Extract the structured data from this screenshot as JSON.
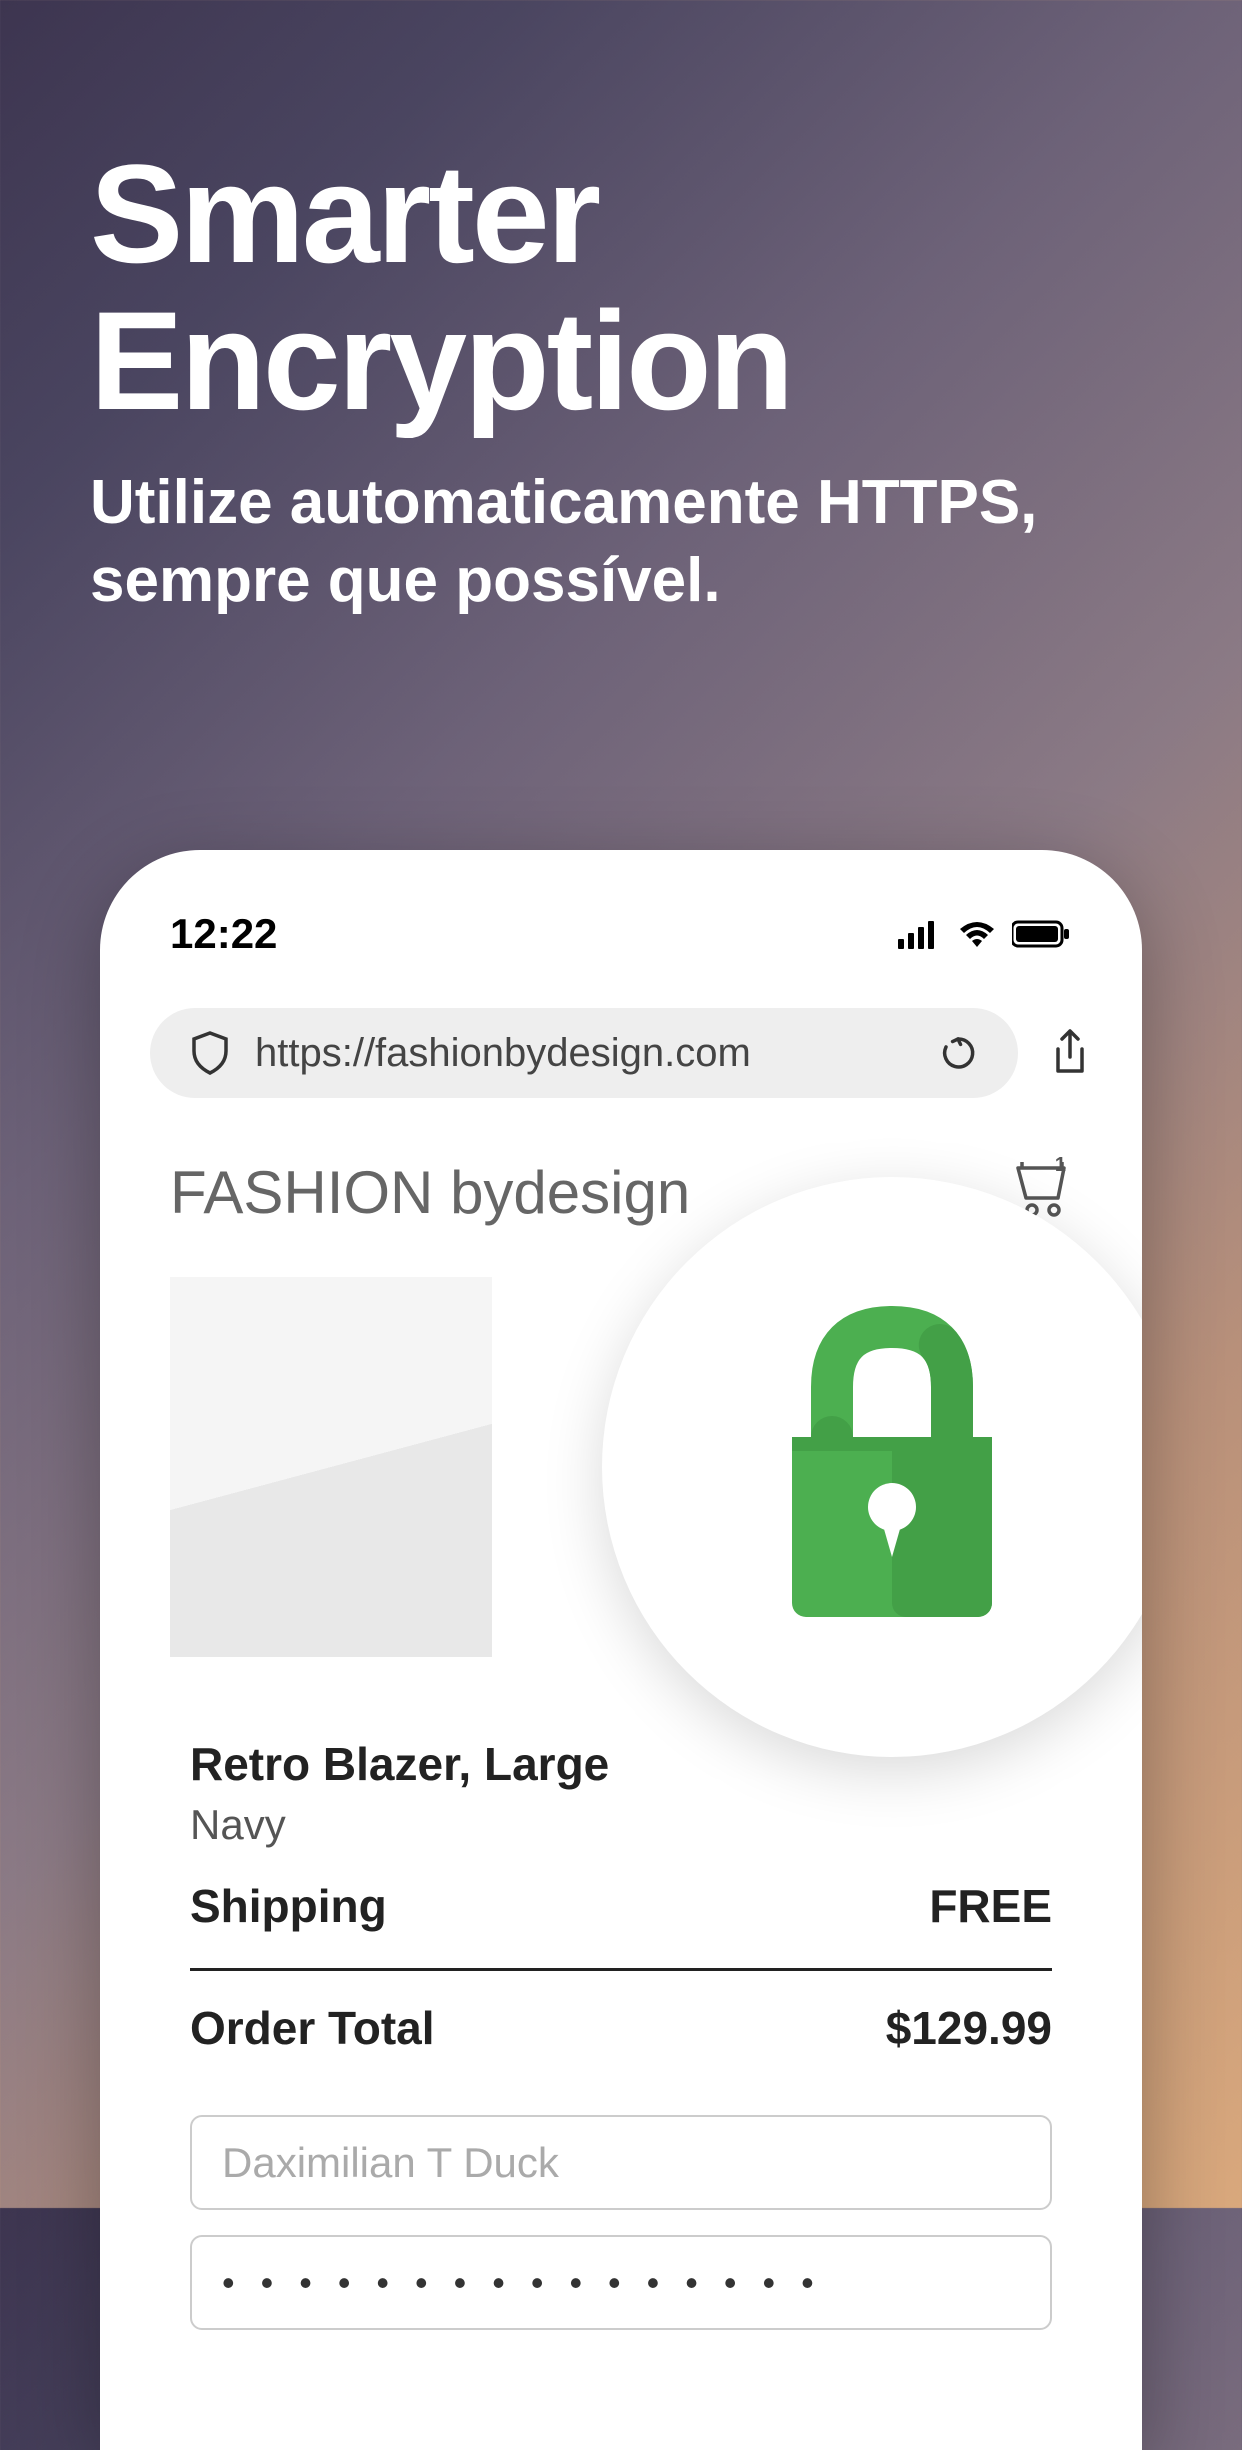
{
  "hero": {
    "title": "Smarter Encryption",
    "subtitle": "Utilize automaticamente HTTPS, sempre que possível."
  },
  "phone": {
    "statusBar": {
      "time": "12:22"
    },
    "addressBar": {
      "url": "https://fashionbydesign.com"
    },
    "site": {
      "titleBold": "FASHION ",
      "titleLight": "bydesign",
      "cartCount": "1"
    },
    "order": {
      "productName": "Retro Blazer, Large",
      "productColor": "Navy",
      "shippingLabel": "Shipping",
      "shippingValue": "FREE",
      "totalLabel": "Order Total",
      "totalValue": "$129.99",
      "nameInput": "Daximilian T Duck",
      "cardInput": "• • • • • • • • • • • • • • • •"
    }
  }
}
